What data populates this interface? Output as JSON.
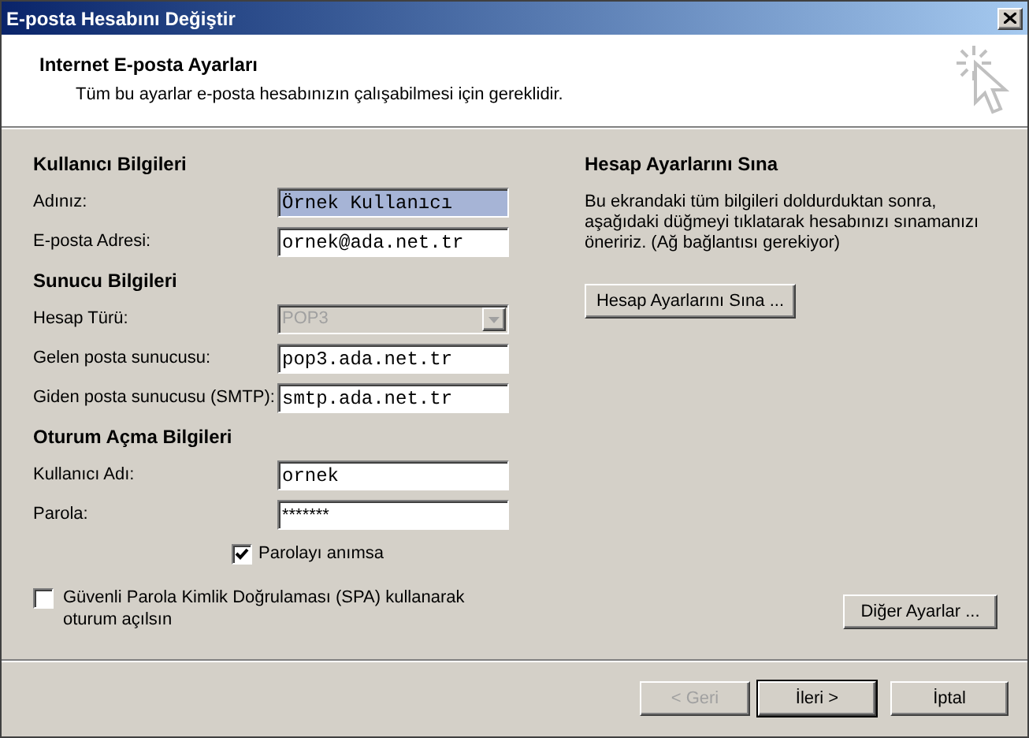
{
  "window": {
    "title": "E-posta Hesabını Değiştir"
  },
  "header": {
    "title": "Internet E-posta Ayarları",
    "subtitle": "Tüm bu ayarlar e-posta hesabınızın çalışabilmesi için gereklidir."
  },
  "sections": [
    {
      "heading": "Kullanıcı Bilgileri",
      "fields": [
        {
          "label": "Adınız:",
          "value": "Örnek Kullanıcı",
          "kind": "text",
          "selected": true,
          "disabled": false
        },
        {
          "label": "E-posta Adresi:",
          "value": "ornek@ada.net.tr",
          "kind": "text",
          "selected": false,
          "disabled": false
        }
      ]
    },
    {
      "heading": "Sunucu Bilgileri",
      "fields": [
        {
          "label": "Hesap Türü:",
          "value": "POP3",
          "kind": "dropdown",
          "disabled": true
        },
        {
          "label": "Gelen posta sunucusu:",
          "value": "pop3.ada.net.tr",
          "kind": "text",
          "selected": false,
          "disabled": false
        },
        {
          "label": "Giden posta sunucusu (SMTP):",
          "value": "smtp.ada.net.tr",
          "kind": "text",
          "selected": false,
          "disabled": false
        }
      ]
    },
    {
      "heading": "Oturum Açma Bilgileri",
      "fields": [
        {
          "label": "Kullanıcı Adı:",
          "value": "ornek",
          "kind": "text",
          "selected": false,
          "disabled": false
        },
        {
          "label": "Parola:",
          "value": "*******",
          "kind": "password",
          "selected": false,
          "disabled": false
        }
      ]
    }
  ],
  "remember_password": {
    "label": "Parolayı anımsa",
    "checked": true
  },
  "spa": {
    "label": "Güvenli Parola Kimlik Doğrulaması (SPA) kullanarak oturum açılsın",
    "checked": false
  },
  "test_panel": {
    "heading": "Hesap Ayarlarını Sına",
    "text": "Bu ekrandaki tüm bilgileri doldurduktan sonra, aşağıdaki düğmeyi tıklatarak hesabınızı sınamanızı öneririz. (Ağ bağlantısı gerekiyor)",
    "button": "Hesap Ayarlarını Sına ..."
  },
  "more_settings_button": "Diğer Ayarlar ...",
  "footer_buttons": [
    {
      "label": "< Geri",
      "disabled": true,
      "default": false
    },
    {
      "label": "İleri >",
      "disabled": false,
      "default": true
    },
    {
      "label": "İptal",
      "disabled": false,
      "default": false
    }
  ]
}
